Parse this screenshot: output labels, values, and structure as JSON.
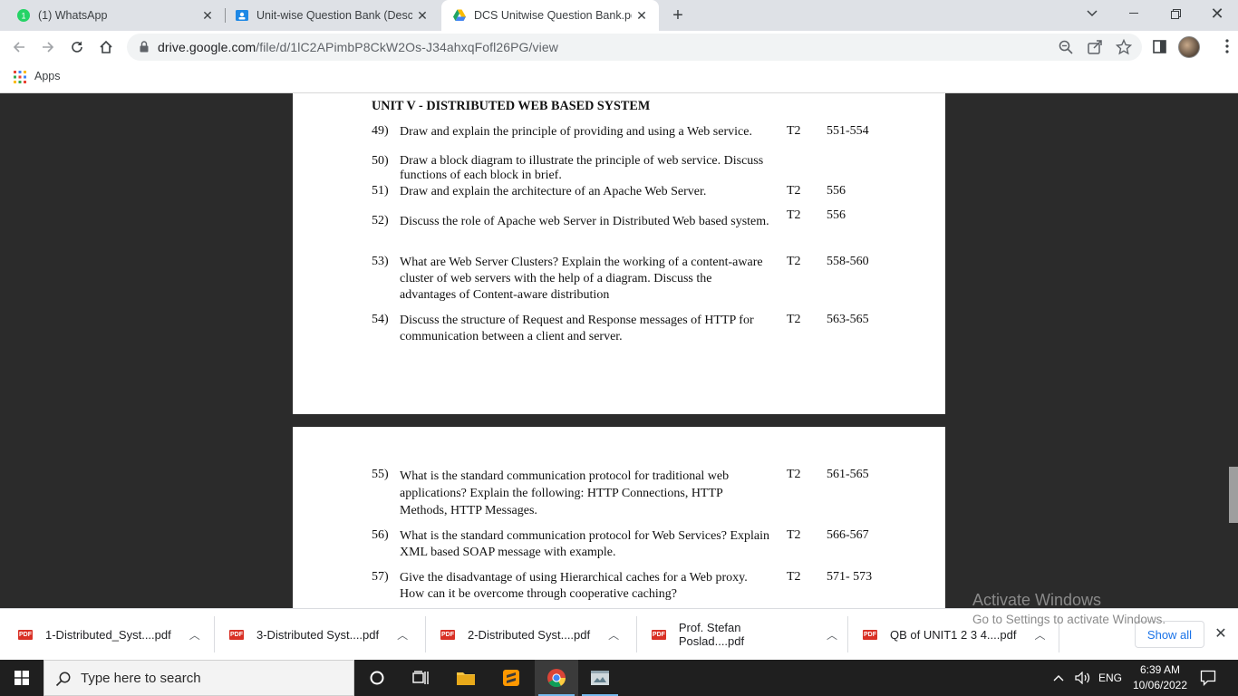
{
  "tabs": [
    {
      "title": "(1) WhatsApp",
      "badge": "1",
      "icon": "whatsapp-icon"
    },
    {
      "title": "Unit-wise Question Bank (Descrip",
      "icon": "classroom-icon"
    },
    {
      "title": "DCS Unitwise Question Bank.pdf",
      "icon": "google-drive-icon",
      "active": true
    }
  ],
  "toolbar": {
    "url_host": "drive.google.com",
    "url_path": "/file/d/1lC2APimbP8CkW2Os-J34ahxqFofl26PG/view"
  },
  "bookmarks": {
    "apps_label": "Apps"
  },
  "document": {
    "unit_title": "UNIT V - DISTRIBUTED WEB BASED SYSTEM",
    "questions": [
      {
        "num": "49)",
        "text": "Draw and explain the principle of providing and using a Web service.",
        "ref": "T2",
        "pages": "551-554"
      },
      {
        "num": "50)",
        "text": "Draw a block diagram to illustrate the principle of web service. Discuss functions of each block in brief.",
        "ref": "",
        "pages": ""
      },
      {
        "num": "51)",
        "text": "Draw and explain the architecture of an Apache Web Server.",
        "ref": "T2",
        "pages": "556"
      },
      {
        "num": "52)",
        "text": "Discuss the role of Apache web Server in Distributed Web based system.",
        "ref": "T2",
        "pages": "556"
      },
      {
        "num": "53)",
        "text": "What are Web Server Clusters? Explain the working of a content-aware cluster of web servers with the help of a diagram. Discuss the advantages of Content-aware distribution",
        "ref": "T2",
        "pages": "558-560"
      },
      {
        "num": "54)",
        "text": "Discuss the structure of Request and Response messages of HTTP for communication between a client and server.",
        "ref": "T2",
        "pages": "563-565"
      },
      {
        "num": "55)",
        "text": "What is the standard communication protocol for traditional web applications? Explain the following: HTTP Connections, HTTP Methods, HTTP Messages.",
        "ref": "T2",
        "pages": "561-565"
      },
      {
        "num": "56)",
        "text": "What is the standard communication protocol for Web Services? Explain XML based SOAP message with example.",
        "ref": "T2",
        "pages": "566-567"
      },
      {
        "num": "57)",
        "text": "Give the disadvantage of using Hierarchical caches for a Web proxy. How can it be overcome through cooperative caching?",
        "ref": "T2",
        "pages": "571- 573"
      }
    ]
  },
  "watermark": {
    "line1": "Activate Windows",
    "line2": "Go to Settings to activate Windows."
  },
  "downloads": {
    "items": [
      {
        "name": "1-Distributed_Syst....pdf"
      },
      {
        "name": "3-Distributed Syst....pdf"
      },
      {
        "name": "2-Distributed Syst....pdf"
      },
      {
        "name": "Prof. Stefan Poslad....pdf"
      },
      {
        "name": "QB of UNIT1 2 3 4....pdf"
      }
    ],
    "show_all": "Show all",
    "file_badge": "PDF"
  },
  "taskbar": {
    "search_placeholder": "Type here to search",
    "language": "ENG",
    "time": "6:39 AM",
    "date": "10/06/2022"
  },
  "colors": {
    "accent_blue": "#1a73e8",
    "pdf_red": "#d93025",
    "viewer_bg": "#2b2b2b"
  }
}
